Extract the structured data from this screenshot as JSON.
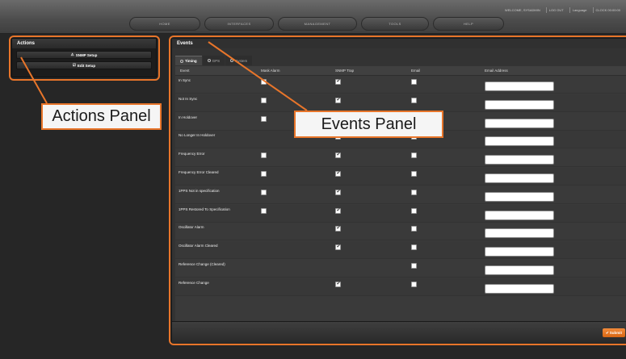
{
  "header": {
    "util_links": [
      "WELCOME, SYSADMIN",
      "LOG OUT",
      "Language",
      "CLOCK 00:00:00"
    ],
    "nav": [
      "HOME",
      "INTERFACES",
      "MANAGEMENT",
      "TOOLS",
      "HELP"
    ]
  },
  "actions": {
    "title": "Actions",
    "buttons": [
      {
        "label": "SNMP Setup",
        "icon": "warning-icon",
        "glyph": "⚠"
      },
      {
        "label": "Edit Setup",
        "icon": "edit-icon",
        "glyph": "☑"
      }
    ]
  },
  "events": {
    "title": "Events",
    "tabs": [
      {
        "label": "Timing",
        "active": true
      },
      {
        "label": "GPS",
        "active": false
      },
      {
        "label": "System",
        "active": false
      }
    ],
    "columns": [
      "Event",
      "Mask Alarm",
      "SNMP Trap",
      "Email",
      "Email Address"
    ],
    "rows": [
      {
        "event": "In Sync",
        "mask": false,
        "snmp": true,
        "email": false,
        "address": ""
      },
      {
        "event": "Not In Sync",
        "mask": false,
        "snmp": true,
        "email": false,
        "address": ""
      },
      {
        "event": "In Holdover",
        "mask": false,
        "snmp": false,
        "email": false,
        "address": ""
      },
      {
        "event": "No Longer In Holdover",
        "mask": null,
        "snmp": true,
        "email": false,
        "address": ""
      },
      {
        "event": "Frequency Error",
        "mask": false,
        "snmp": true,
        "email": false,
        "address": ""
      },
      {
        "event": "Frequency Error Cleared",
        "mask": false,
        "snmp": true,
        "email": false,
        "address": ""
      },
      {
        "event": "1PPS Not in specification",
        "mask": false,
        "snmp": true,
        "email": false,
        "address": ""
      },
      {
        "event": "1PPS Restored To Specification",
        "mask": false,
        "snmp": true,
        "email": false,
        "address": ""
      },
      {
        "event": "Oscillator Alarm",
        "mask": null,
        "snmp": true,
        "email": false,
        "address": ""
      },
      {
        "event": "Oscillator Alarm Cleared",
        "mask": null,
        "snmp": true,
        "email": false,
        "address": ""
      },
      {
        "event": "Reference Change (Cleared)",
        "mask": null,
        "snmp": null,
        "email": false,
        "address": ""
      },
      {
        "event": "Reference Change",
        "mask": null,
        "snmp": true,
        "email": false,
        "address": ""
      }
    ],
    "submit_label": "Submit"
  },
  "callouts": {
    "actions_panel": "Actions Panel",
    "events_panel": "Events Panel"
  },
  "colors": {
    "accent": "#e8752a",
    "submit": "#e87120"
  }
}
